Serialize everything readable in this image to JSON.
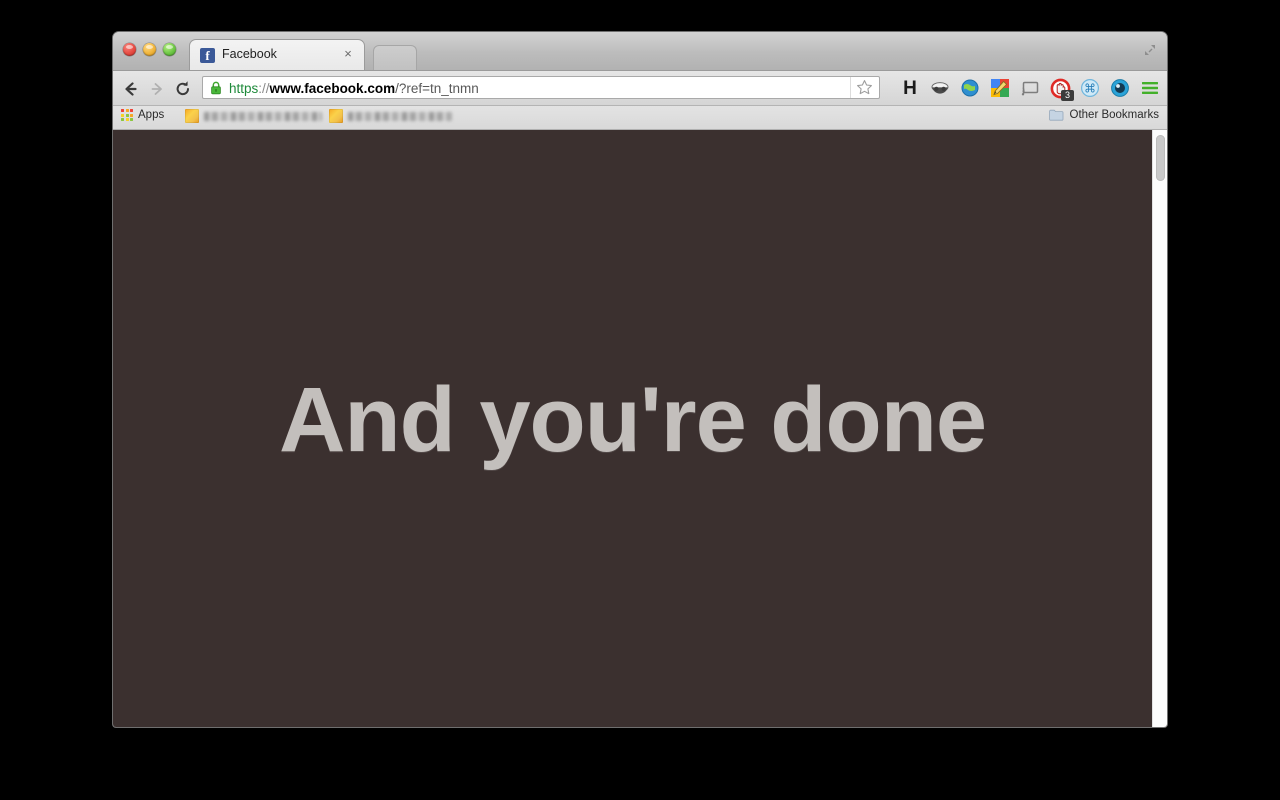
{
  "window": {
    "controls": [
      {
        "name": "close-button",
        "color": "#e64b42"
      },
      {
        "name": "minimize-button",
        "color": "#f0b43a"
      },
      {
        "name": "zoom-button",
        "color": "#6cc644"
      }
    ],
    "expand_icon": "fullscreen-expand-icon"
  },
  "tabs": {
    "active": {
      "title": "Facebook",
      "favicon_letter": "f",
      "favicon_color": "#3b5998",
      "close_label": "×"
    },
    "new_tab_label": ""
  },
  "toolbar": {
    "back_icon": "back-arrow-icon",
    "forward_icon": "forward-arrow-icon",
    "reload_icon": "reload-icon",
    "lock_icon": "secure-lock-icon",
    "lock_color": "#3fa72f",
    "star_icon": "bookmark-star-icon",
    "url": {
      "full": "https://www.facebook.com/?ref=tn_tnmn",
      "scheme": "https",
      "separator": "://",
      "host": "www.facebook.com",
      "path": "/?ref=tn_tnmn"
    },
    "extensions": [
      {
        "name": "h-letter-icon",
        "glyph": "H"
      },
      {
        "name": "incognito-mask-icon",
        "glyph": ""
      },
      {
        "name": "globe-icon",
        "glyph": ""
      },
      {
        "name": "google-keep-pencil-icon",
        "glyph": ""
      },
      {
        "name": "cast-screen-icon",
        "glyph": ""
      },
      {
        "name": "adblock-hand-icon",
        "glyph": "",
        "badge": "3"
      },
      {
        "name": "command-key-icon",
        "glyph": "⌘"
      },
      {
        "name": "blue-circle-icon",
        "glyph": ""
      },
      {
        "name": "chrome-menu-icon",
        "glyph": ""
      }
    ]
  },
  "bookmarks_bar": {
    "apps_label": "Apps",
    "items": [
      {
        "label": "",
        "redacted": true
      },
      {
        "label": "",
        "redacted": true
      }
    ],
    "other_bookmarks_label": "Other Bookmarks",
    "folder_icon": "folder-icon"
  },
  "page": {
    "headline": "And you're done",
    "background_color": "#3b302f",
    "text_color": "#c3bfbc"
  },
  "scrollbar": {
    "position": "top"
  }
}
